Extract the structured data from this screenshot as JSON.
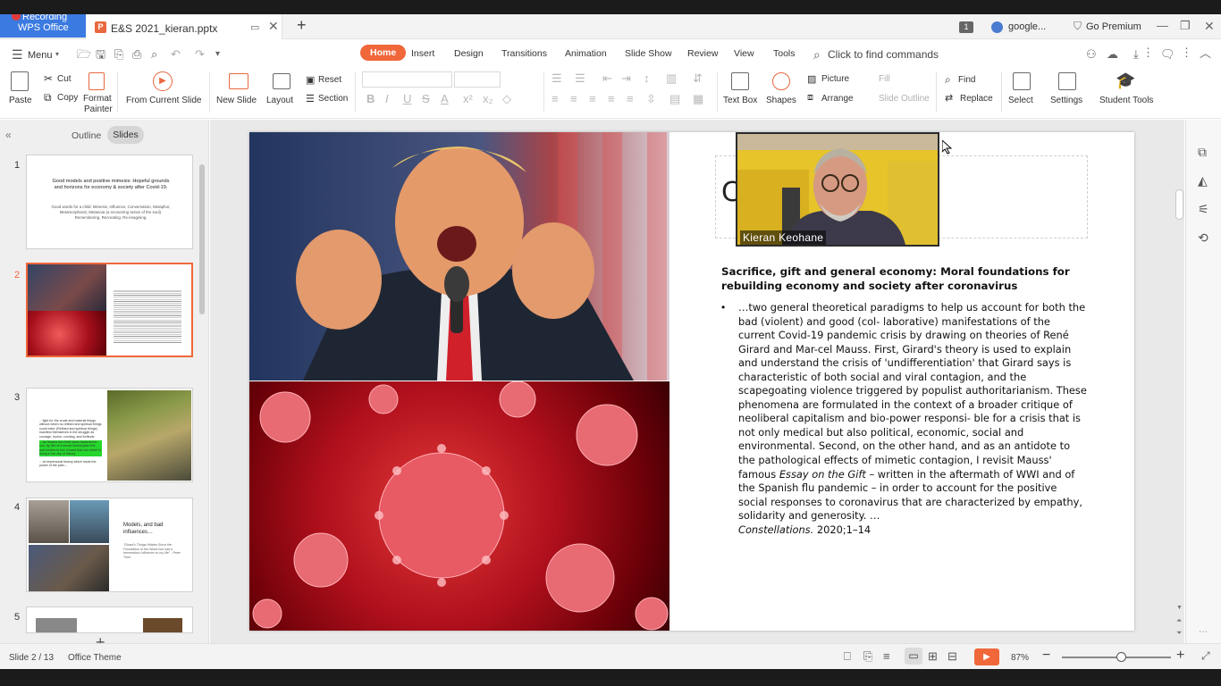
{
  "recording": {
    "label": "Recording"
  },
  "titlebar": {
    "app_tab": "WPS Office",
    "file_tab": "E&S 2021_kieran.pptx",
    "new_tab": "+",
    "badge": "1",
    "account": "google...",
    "premium": "Go Premium"
  },
  "menu": {
    "menu_label": "Menu",
    "tabs": [
      "Home",
      "Insert",
      "Design",
      "Transitions",
      "Animation",
      "Slide Show",
      "Review",
      "View",
      "Tools"
    ],
    "search_placeholder": "Click to find commands"
  },
  "ribbon": {
    "paste": "Paste",
    "cut": "Cut",
    "copy": "Copy",
    "format_painter_1": "Format",
    "format_painter_2": "Painter",
    "from_current_slide": "From Current Slide",
    "new_slide": "New Slide",
    "layout": "Layout",
    "reset": "Reset",
    "section": "Section",
    "text_box": "Text Box",
    "shapes": "Shapes",
    "picture": "Picture",
    "fill": "Fill",
    "arrange": "Arrange",
    "slide_outline": "Slide Outline",
    "find": "Find",
    "replace": "Replace",
    "select": "Select",
    "settings": "Settings",
    "student_tools": "Student Tools"
  },
  "panel": {
    "outline_tab": "Outline",
    "slides_tab": "Slides",
    "thumbs": [
      {
        "num": "1",
        "title": "Good models and positive mimesis: Hopeful grounds and horizons for economy & society after Covid-19.",
        "sub": "Good words for a child: Mimesis, Influence, Conversation, Metaphor, Metamorphosis; Metanoia (a recovering sense of the soul). Remembering. Recreating. Re-imagining."
      },
      {
        "num": "2"
      },
      {
        "num": "3",
        "text": "…fight for the crude and material things without which no refined and spiritual things could exist. (Refined and spiritual things) manifest themselves in the struggle as courage, humor, cunning, and fortitude.",
        "text2": "…As flowers turn their faces towards the sun, by dint of a secret heliotropism the past strives to turn toward that sun which is rising in the sky of history.",
        "text3": "…an impersonal history which resist the power of the past…"
      },
      {
        "num": "4",
        "title": "Models, and bad influences…",
        "quote": "\"Girard's Things Hidden Since the Foundation of the World has had a tremendous influence on my life\" - Peter Thiel"
      },
      {
        "num": "5"
      }
    ],
    "add_slide": "+"
  },
  "slide": {
    "heading": "Sacrifice, gift and general economy: Moral foundations for rebuilding economy and society after coronavirus",
    "bullet": "•",
    "body_main": "…two general theoretical paradigms to help us account for both the bad (violent) and good (col- laborative) manifestations of the current Covid-19 pandemic crisis by drawing on theories of René Girard and Mar-cel Mauss. First, Girard's theory is used to explain and understand the crisis of 'undifferentiation' that Girard says is characteristic of both social and viral contagion, and the scapegoating violence triggered by populist authoritarianism. These phenomena are formulated in the context of a broader critique of neoliberal capitalism and bio-power responsi- ble for a crisis that is not only medical but also political, economic, social and environmental. Second, on the other hand, and as an antidote to the pathological effects of mimetic contagion, I revisit Mauss' famous",
    "body_italic": "Essay on the Gift",
    "body_end": " – written in the aftermath of WWI and of the Spanish flu pandemic – in order to account for the positive social responses to coronavirus that are characterized by empathy, solidarity and generosity. …",
    "citation_journal": "Constellations.",
    "citation_rest": " 2020;1–14",
    "title_partial": "C"
  },
  "video": {
    "name": "Kieran Keohane"
  },
  "status": {
    "slide_counter": "Slide 2 / 13",
    "theme": "Office Theme",
    "zoom": "87%",
    "zoom_level": 0.55
  },
  "colors": {
    "accent": "#f0673a",
    "wps_blue": "#3b7ae0",
    "virus_red": "#c8101c"
  }
}
